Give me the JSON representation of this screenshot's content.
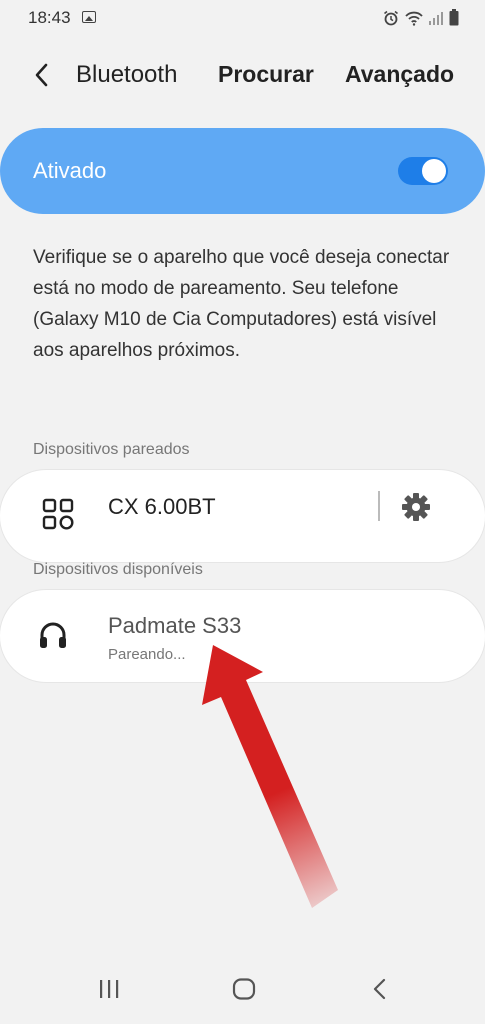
{
  "status_bar": {
    "time": "18:43"
  },
  "app_bar": {
    "title": "Bluetooth",
    "actions": [
      "Procurar",
      "Avançado"
    ]
  },
  "master_switch": {
    "label": "Ativado",
    "on": true
  },
  "description": "Verifique se o aparelho que você deseja conectar está no modo de pareamento. Seu telefone (Galaxy M10 de Cia Computadores) está visível aos aparelhos próximos.",
  "paired": {
    "header": "Dispositivos pareados",
    "devices": [
      {
        "name": "CX 6.00BT",
        "icon": "grid-device-icon"
      }
    ]
  },
  "available": {
    "header": "Dispositivos disponíveis",
    "devices": [
      {
        "name": "Padmate S33",
        "status": "Pareando...",
        "icon": "headphones-icon"
      }
    ]
  },
  "colors": {
    "accent": "#5fa9f4",
    "toggle": "#1e7ee8",
    "arrow": "#d42020"
  }
}
